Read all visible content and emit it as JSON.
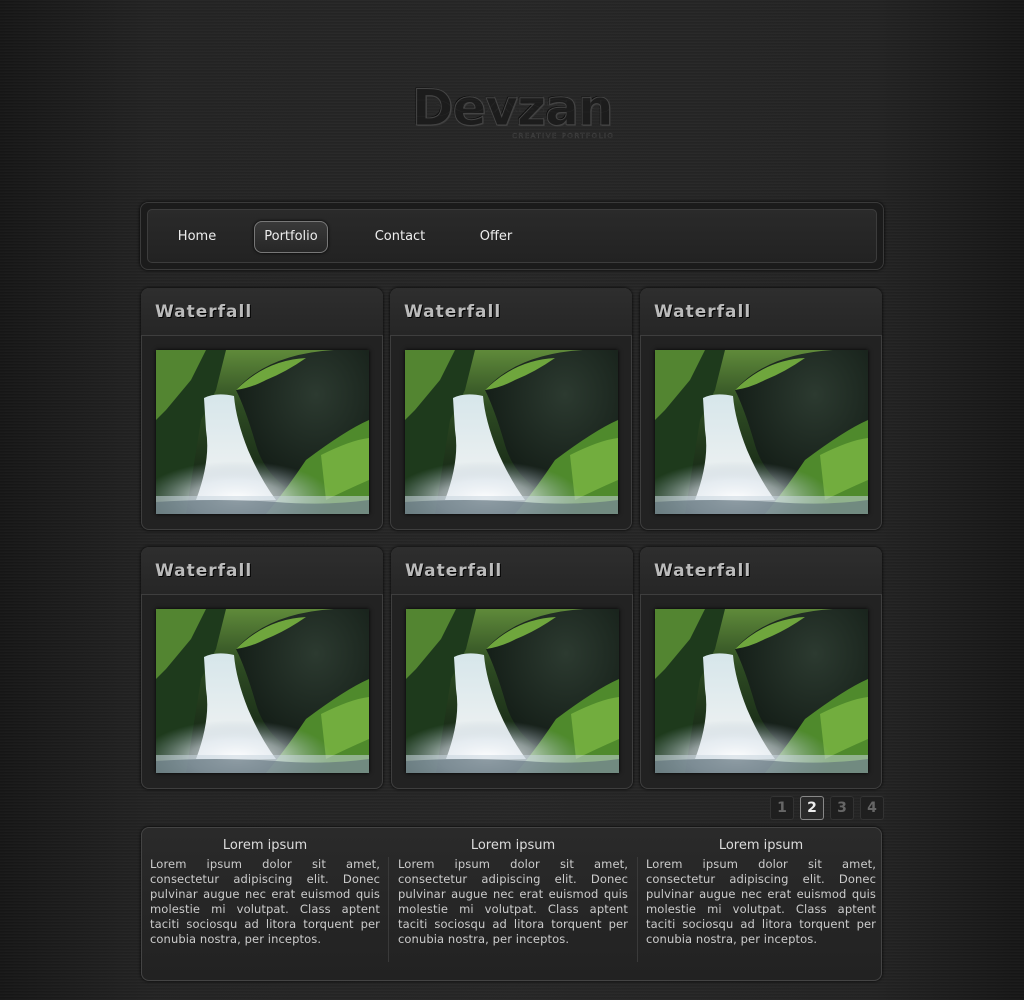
{
  "logo": {
    "name": "Devzan",
    "tagline": "CREATIVE PORTFOLIO"
  },
  "nav": {
    "items": [
      {
        "label": "Home",
        "active": false
      },
      {
        "label": "Portfolio",
        "active": true
      },
      {
        "label": "Contact",
        "active": false
      },
      {
        "label": "Offer",
        "active": false
      }
    ]
  },
  "gallery": {
    "items": [
      {
        "title": "Waterfall"
      },
      {
        "title": "Waterfall"
      },
      {
        "title": "Waterfall"
      },
      {
        "title": "Waterfall"
      },
      {
        "title": "Waterfall"
      },
      {
        "title": "Waterfall"
      }
    ]
  },
  "pagination": {
    "pages": [
      "1",
      "2",
      "3",
      "4"
    ],
    "current": "2"
  },
  "footer": {
    "columns": [
      {
        "title": "Lorem ipsum",
        "text": "Lorem ipsum dolor sit amet, consectetur adipiscing elit. Donec pulvinar augue nec erat euismod quis molestie mi volutpat. Class aptent taciti sociosqu ad litora torquent per conubia nostra, per inceptos."
      },
      {
        "title": "Lorem ipsum",
        "text": "Lorem ipsum dolor sit amet, consectetur adipiscing elit. Donec pulvinar augue nec erat euismod quis molestie mi volutpat. Class aptent taciti sociosqu ad litora torquent per conubia nostra, per inceptos."
      },
      {
        "title": "Lorem ipsum",
        "text": "Lorem ipsum dolor sit amet, consectetur adipiscing elit. Donec pulvinar augue nec erat euismod quis molestie mi volutpat. Class aptent taciti sociosqu ad litora torquent per conubia nostra, per inceptos."
      }
    ]
  }
}
